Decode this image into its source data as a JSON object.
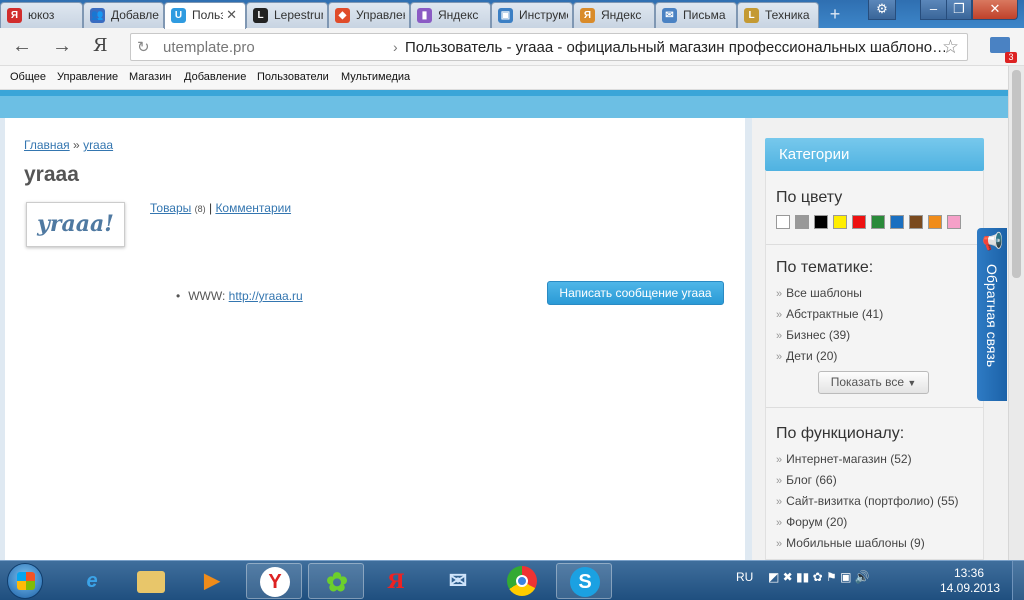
{
  "browser": {
    "tabs": [
      {
        "label": "юкоз",
        "icon": "yandex-icon",
        "color": "#d12d2d",
        "glyph": "Я"
      },
      {
        "label": "Добавление",
        "icon": "users-icon",
        "color": "#3a6cc0",
        "glyph": "👥"
      },
      {
        "label": "Пользователь",
        "icon": "ucoz-icon",
        "color": "#2f9be0",
        "glyph": "U",
        "active": true
      },
      {
        "label": "Lepestrum",
        "icon": "l-icon",
        "color": "#222222",
        "glyph": "L"
      },
      {
        "label": "Управление",
        "icon": "ucoz-red-icon",
        "color": "#e04c2a",
        "glyph": "◆"
      },
      {
        "label": "Яндекс",
        "icon": "chart-icon",
        "color": "#8b5bc4",
        "glyph": "▮"
      },
      {
        "label": "Инструменты",
        "icon": "window-icon",
        "color": "#3b7fc4",
        "glyph": "▣"
      },
      {
        "label": "Яндекс",
        "icon": "fox-icon",
        "color": "#d98b2a",
        "glyph": "Я"
      },
      {
        "label": "Письма",
        "icon": "mail-icon",
        "color": "#4a82c3",
        "glyph": "✉"
      },
      {
        "label": "Техника",
        "icon": "book-icon",
        "color": "#c49a33",
        "glyph": "L"
      }
    ],
    "address": {
      "domain": "utemplate.pro",
      "separator": "›",
      "page_title": "Пользователь - yraaa - официальный магазин профессиональных шаблоно…"
    },
    "mail_badge": "3"
  },
  "sitemenu": [
    "Общее",
    "Управление",
    "Магазин",
    "Добавление",
    "Пользователи",
    "Мультимедиа"
  ],
  "page": {
    "breadcrumb_home": "Главная",
    "breadcrumb_sep": "»",
    "breadcrumb_current": "yraaa",
    "title": "yraaa",
    "avatar_text": "yraaa!",
    "link_goods": "Товары",
    "goods_count": "(8)",
    "link_sep": "|",
    "link_comments": "Комментарии",
    "www_label": "WWW:",
    "www_url": "http://yraaa.ru",
    "message_button": "Написать сообщение yraaa"
  },
  "sidebar": {
    "header": "Категории",
    "by_color": "По цвету",
    "colors": [
      "#ffffff",
      "#999999",
      "#000000",
      "#ffee00",
      "#ee1111",
      "#2a8a3a",
      "#1a6fc0",
      "#7a4a1e",
      "#f08c1a",
      "#f5a0c8"
    ],
    "by_theme": "По тематике:",
    "theme_items": [
      "Все шаблоны",
      "Абстрактные (41)",
      "Бизнес (39)",
      "Дети (20)"
    ],
    "show_all": "Показать все",
    "by_function": "По функционалу:",
    "function_items": [
      "Интернет-магазин (52)",
      "Блог (66)",
      "Сайт-визитка (портфолио) (55)",
      "Форум (20)",
      "Мобильные шаблоны (9)"
    ]
  },
  "feedback": "Обратная связь",
  "taskbar": {
    "lang": "RU",
    "time": "13:36",
    "date": "14.09.2013"
  }
}
